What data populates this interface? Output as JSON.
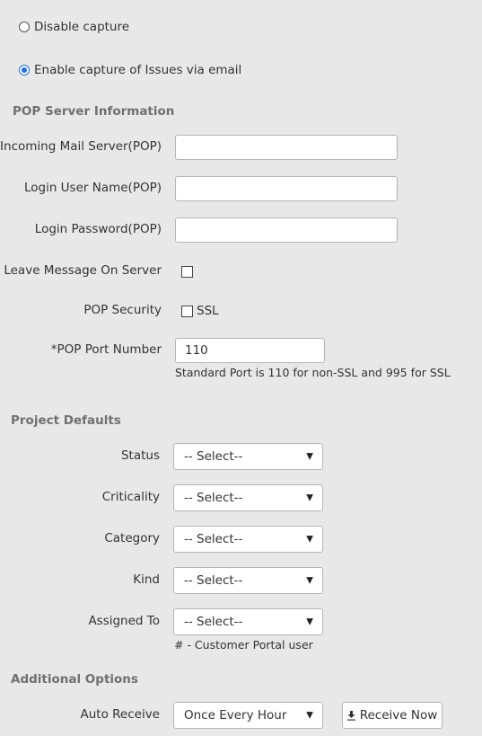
{
  "capture": {
    "options": [
      {
        "label": "Disable capture",
        "checked": false
      },
      {
        "label": "Enable capture of Issues via email",
        "checked": true
      }
    ]
  },
  "pop_server": {
    "title": "POP Server Information",
    "incoming_mail_server": {
      "label": "Incoming Mail Server(POP)",
      "value": ""
    },
    "login_user_name": {
      "label": "Login User Name(POP)",
      "value": ""
    },
    "login_password": {
      "label": "Login Password(POP)",
      "value": ""
    },
    "leave_message": {
      "label": "Leave Message On Server",
      "checked": false
    },
    "pop_security": {
      "label": "POP Security",
      "option_label": "SSL",
      "checked": false
    },
    "port_number": {
      "label": "*POP Port Number",
      "value": "110",
      "hint": "Standard Port is 110 for non-SSL and 995 for SSL"
    }
  },
  "project_defaults": {
    "title": "Project Defaults",
    "fields": [
      {
        "label": "Status",
        "value": "-- Select--"
      },
      {
        "label": "Criticality",
        "value": "-- Select--"
      },
      {
        "label": "Category",
        "value": "-- Select--"
      },
      {
        "label": "Kind",
        "value": "-- Select--"
      },
      {
        "label": "Assigned To",
        "value": "-- Select--"
      }
    ],
    "assigned_hint": "# - Customer Portal user"
  },
  "additional_options": {
    "title": "Additional Options",
    "auto_receive": {
      "label": "Auto Receive",
      "value": "Once Every Hour"
    },
    "receive_now_label": "Receive Now"
  },
  "colors": {
    "accent": "#1e6fd9",
    "background": "#e8e8e8",
    "section_title": "#707070"
  }
}
